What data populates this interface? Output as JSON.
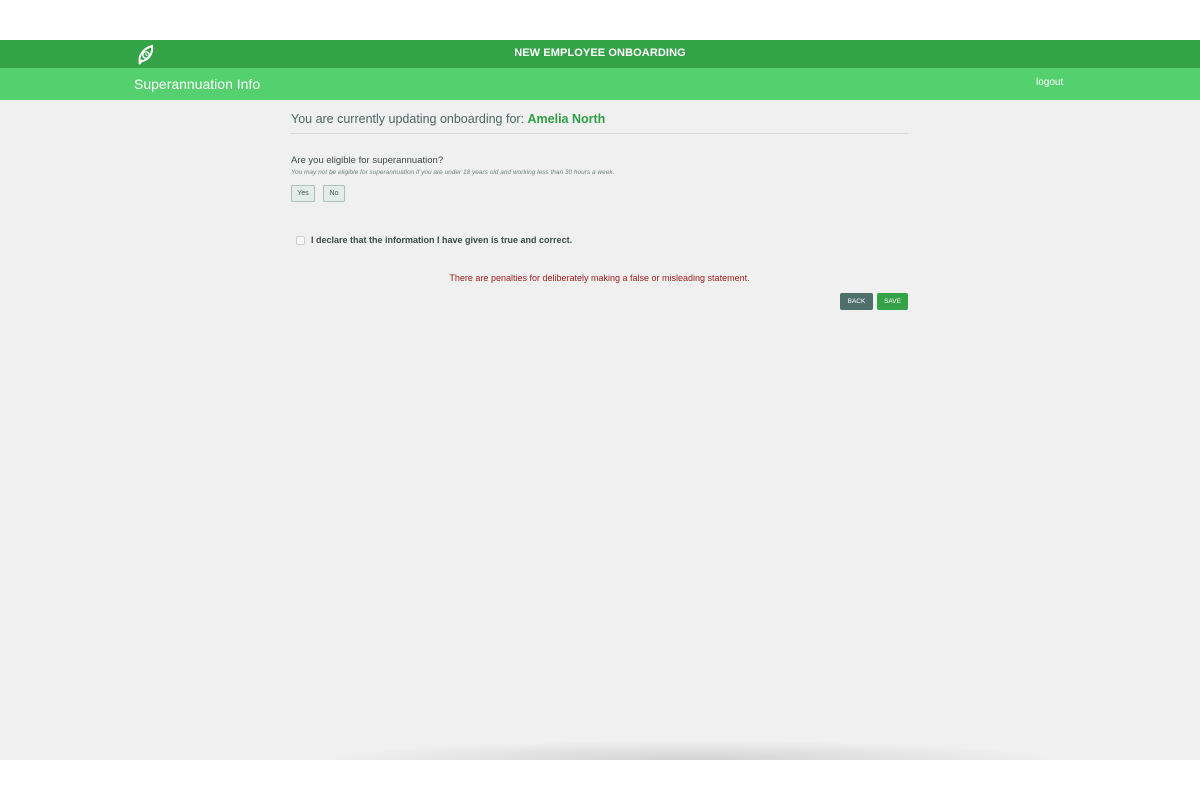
{
  "header": {
    "title": "NEW EMPLOYEE ONBOARDING",
    "logo_icon": "leaf-clock-icon"
  },
  "subheader": {
    "page_title": "Superannuation Info",
    "logout_label": "logout"
  },
  "employee": {
    "prefix": "You are currently updating onboarding for: ",
    "name": "Amelia North"
  },
  "superannuation": {
    "question": "Are you eligible for superannuation?",
    "hint": "You may not be eligible for superannuation if you are under 18 years old and working less than 30 hours a week.",
    "yes_label": "Yes",
    "no_label": "No"
  },
  "declaration": {
    "label": "I declare that the information I have given is true and correct.",
    "checked": false
  },
  "penalty_notice": "There are penalties for deliberately making a false or misleading statement.",
  "actions": {
    "back_label": "BACK",
    "save_label": "SAVE"
  },
  "colors": {
    "header": "#34a247",
    "subheader": "#55d06f",
    "accent": "#2f9e44",
    "penalty": "#a01c1c",
    "back_button": "#4f6f6b"
  }
}
